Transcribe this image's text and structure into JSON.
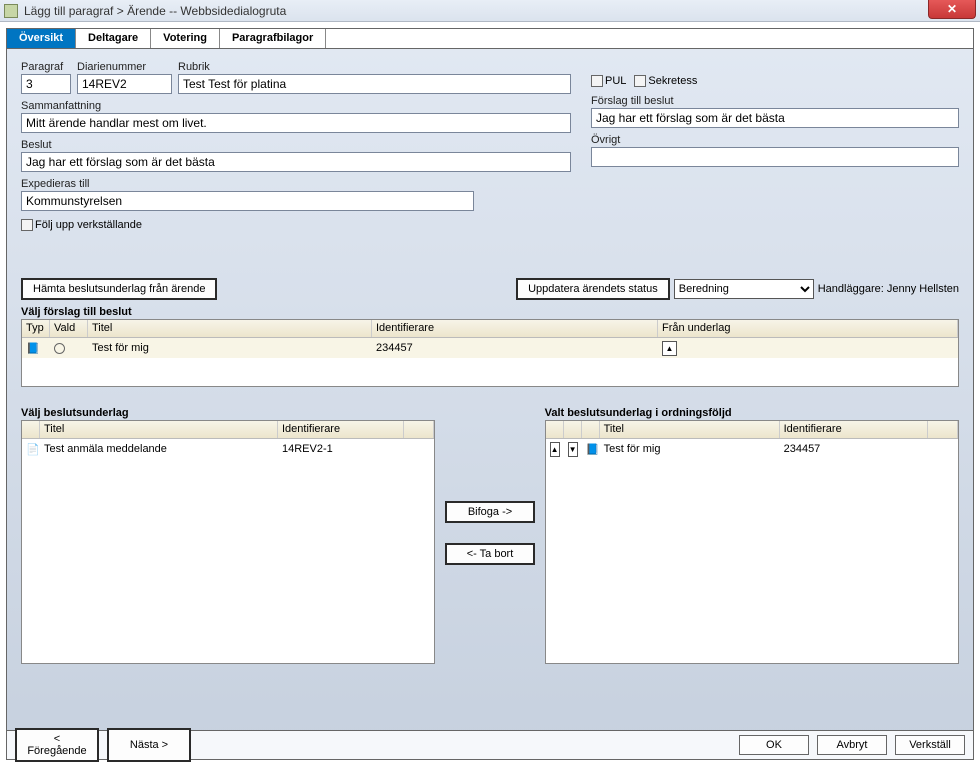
{
  "window": {
    "title": "Lägg till paragraf > Ärende -- Webbsidedialogruta"
  },
  "tabs": [
    {
      "label": "Översikt",
      "active": true
    },
    {
      "label": "Deltagare",
      "active": false
    },
    {
      "label": "Votering",
      "active": false
    },
    {
      "label": "Paragrafbilagor",
      "active": false
    }
  ],
  "fields": {
    "paragraf_label": "Paragraf",
    "paragraf_value": "3",
    "diarie_label": "Diarienummer",
    "diarie_value": "14REV2",
    "rubrik_label": "Rubrik",
    "rubrik_value": "Test Test för platina",
    "sammanfattning_label": "Sammanfattning",
    "sammanfattning_value": "Mitt ärende handlar mest om livet.",
    "beslut_label": "Beslut",
    "beslut_value": "Jag har ett förslag som är det bästa",
    "expedieras_label": "Expedieras till",
    "expedieras_value": "Kommunstyrelsen",
    "pul_label": "PUL",
    "sekretess_label": "Sekretess",
    "forslag_label": "Förslag till beslut",
    "forslag_value": "Jag har ett förslag som är det bästa",
    "ovrigt_label": "Övrigt",
    "ovrigt_value": "",
    "folj_label": "Följ upp verkställande"
  },
  "buttons": {
    "hamta": "Hämta beslutsunderlag från ärende",
    "uppdatera": "Uppdatera ärendets status",
    "bifoga": "Bifoga ->",
    "ta_bort": "<- Ta bort",
    "prev": "< Föregående",
    "next": "Nästa >",
    "ok": "OK",
    "cancel": "Avbryt",
    "apply": "Verkställ"
  },
  "status": {
    "selected": "Beredning",
    "handlaggare_label": "Handläggare: Jenny Hellsten"
  },
  "forslag_grid": {
    "title": "Välj förslag till beslut",
    "headers": {
      "typ": "Typ",
      "vald": "Vald",
      "titel": "Titel",
      "identifierare": "Identifierare",
      "fran": "Från underlag"
    },
    "row": {
      "titel": "Test för mig",
      "identifierare": "234457"
    }
  },
  "left_list": {
    "title": "Välj beslutsunderlag",
    "headers": {
      "titel": "Titel",
      "identifierare": "Identifierare"
    },
    "row": {
      "titel": "Test anmäla meddelande",
      "identifierare": "14REV2-1"
    }
  },
  "right_list": {
    "title": "Valt beslutsunderlag i ordningsföljd",
    "headers": {
      "titel": "Titel",
      "identifierare": "Identifierare"
    },
    "row": {
      "titel": "Test för mig",
      "identifierare": "234457"
    }
  }
}
